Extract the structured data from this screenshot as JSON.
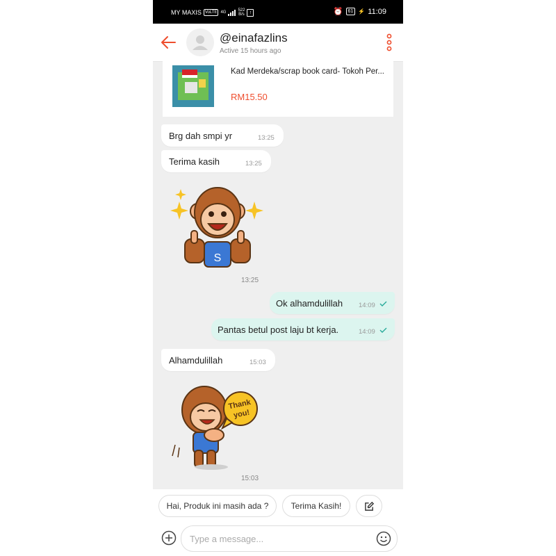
{
  "status_bar": {
    "carrier": "MY MAXIS",
    "volte": "VoLTE",
    "network": "4G",
    "speed_top": "522",
    "speed_bottom": "B/s",
    "battery": "61",
    "time": "11:09"
  },
  "header": {
    "username": "@einafazlins",
    "status": "Active 15 hours ago"
  },
  "product": {
    "title": "Kad Merdeka/scrap book card- Tokoh Per...",
    "price": "RM15.50"
  },
  "messages": [
    {
      "text": "Brg dah smpi yr",
      "time": "13:25"
    },
    {
      "text": "Terima kasih",
      "time": "13:25"
    },
    {
      "sticker_time": "13:25",
      "badge": "S"
    },
    {
      "text": "Ok alhamdulillah",
      "time": "14:09"
    },
    {
      "text": "Pantas betul post laju bt kerja.",
      "time": "14:09"
    },
    {
      "text": "Alhamdulillah",
      "time": "15:03"
    },
    {
      "sticker_time": "15:03",
      "sticker_text_1": "Thank",
      "sticker_text_2": "you!"
    }
  ],
  "quick_replies": [
    {
      "label": "Hai, Produk ini masih ada ?"
    },
    {
      "label": "Terima Kasih!"
    }
  ],
  "composer": {
    "placeholder": "Type a message..."
  },
  "colors": {
    "accent": "#ee4d2d",
    "outgoing_bubble": "#dcf5ef",
    "chat_background": "#efefef",
    "read_tick": "#26aa99"
  }
}
